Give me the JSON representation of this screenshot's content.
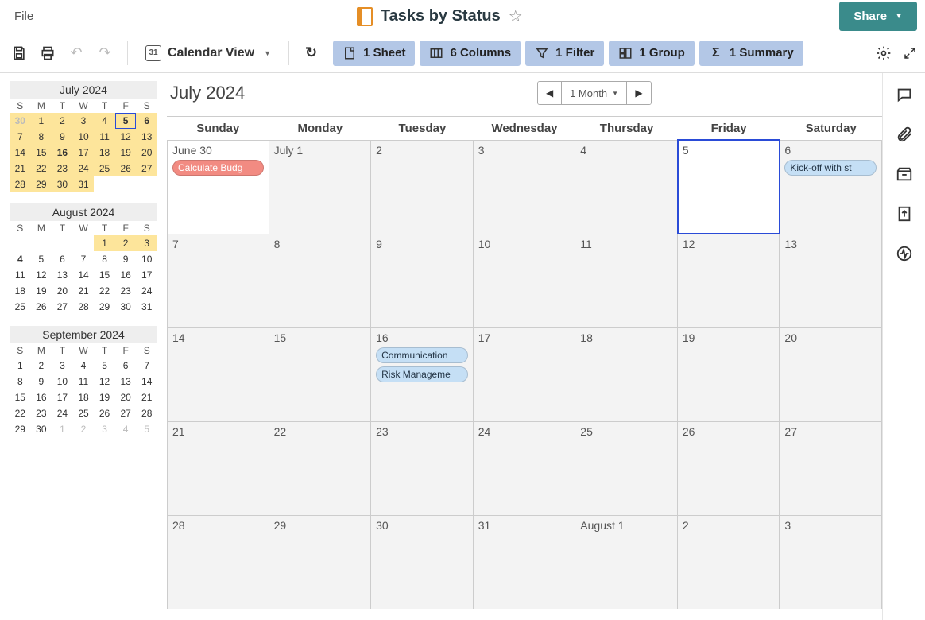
{
  "header": {
    "file_menu": "File",
    "title": "Tasks by Status",
    "share_label": "Share"
  },
  "toolbar": {
    "view_label": "Calendar View",
    "pills": {
      "sheet": "1 Sheet",
      "columns": "6 Columns",
      "filter": "1 Filter",
      "group": "1 Group",
      "summary": "1 Summary"
    }
  },
  "main": {
    "month_title": "July 2024",
    "range_label": "1 Month",
    "weekdays": [
      "Sunday",
      "Monday",
      "Tuesday",
      "Wednesday",
      "Thursday",
      "Friday",
      "Saturday"
    ],
    "rows": [
      [
        {
          "label": "June 30",
          "white": true,
          "events": [
            {
              "text": "Calculate Budg",
              "color": "red"
            }
          ]
        },
        {
          "label": "July 1"
        },
        {
          "label": "2"
        },
        {
          "label": "3"
        },
        {
          "label": "4"
        },
        {
          "label": "5",
          "selected": true
        },
        {
          "label": "6",
          "events": [
            {
              "text": "Kick-off with st",
              "color": "blue"
            }
          ]
        }
      ],
      [
        {
          "label": "7"
        },
        {
          "label": "8"
        },
        {
          "label": "9"
        },
        {
          "label": "10"
        },
        {
          "label": "11"
        },
        {
          "label": "12"
        },
        {
          "label": "13"
        }
      ],
      [
        {
          "label": "14"
        },
        {
          "label": "15"
        },
        {
          "label": "16",
          "events": [
            {
              "text": "Communication",
              "color": "blue"
            },
            {
              "text": "Risk Manageme",
              "color": "blue"
            }
          ]
        },
        {
          "label": "17"
        },
        {
          "label": "18"
        },
        {
          "label": "19"
        },
        {
          "label": "20"
        }
      ],
      [
        {
          "label": "21"
        },
        {
          "label": "22"
        },
        {
          "label": "23"
        },
        {
          "label": "24"
        },
        {
          "label": "25"
        },
        {
          "label": "26"
        },
        {
          "label": "27"
        }
      ],
      [
        {
          "label": "28"
        },
        {
          "label": "29"
        },
        {
          "label": "30"
        },
        {
          "label": "31"
        },
        {
          "label": "August 1"
        },
        {
          "label": "2"
        },
        {
          "label": "3"
        }
      ]
    ]
  },
  "mini_calendars": [
    {
      "title": "July 2024",
      "dow": [
        "S",
        "M",
        "T",
        "W",
        "T",
        "F",
        "S"
      ],
      "days": [
        {
          "n": "30",
          "dim": true,
          "hl": true,
          "bold": true
        },
        {
          "n": "1",
          "hl": true
        },
        {
          "n": "2",
          "hl": true
        },
        {
          "n": "3",
          "hl": true
        },
        {
          "n": "4",
          "hl": true
        },
        {
          "n": "5",
          "hl": true,
          "today": true
        },
        {
          "n": "6",
          "hl": true,
          "bold": true
        },
        {
          "n": "7",
          "hl": true
        },
        {
          "n": "8",
          "hl": true
        },
        {
          "n": "9",
          "hl": true
        },
        {
          "n": "10",
          "hl": true
        },
        {
          "n": "11",
          "hl": true
        },
        {
          "n": "12",
          "hl": true
        },
        {
          "n": "13",
          "hl": true
        },
        {
          "n": "14",
          "hl": true
        },
        {
          "n": "15",
          "hl": true
        },
        {
          "n": "16",
          "hl": true,
          "bold": true
        },
        {
          "n": "17",
          "hl": true
        },
        {
          "n": "18",
          "hl": true
        },
        {
          "n": "19",
          "hl": true
        },
        {
          "n": "20",
          "hl": true
        },
        {
          "n": "21",
          "hl": true
        },
        {
          "n": "22",
          "hl": true
        },
        {
          "n": "23",
          "hl": true
        },
        {
          "n": "24",
          "hl": true
        },
        {
          "n": "25",
          "hl": true
        },
        {
          "n": "26",
          "hl": true
        },
        {
          "n": "27",
          "hl": true
        },
        {
          "n": "28",
          "hl": true
        },
        {
          "n": "29",
          "hl": true
        },
        {
          "n": "30",
          "hl": true
        },
        {
          "n": "31",
          "hl": true
        }
      ]
    },
    {
      "title": "August 2024",
      "dow": [
        "S",
        "M",
        "T",
        "W",
        "T",
        "F",
        "S"
      ],
      "days": [
        {
          "n": ""
        },
        {
          "n": ""
        },
        {
          "n": ""
        },
        {
          "n": ""
        },
        {
          "n": "1",
          "hl": true
        },
        {
          "n": "2",
          "hl": true
        },
        {
          "n": "3",
          "hl": true
        },
        {
          "n": "4",
          "bold": true
        },
        {
          "n": "5"
        },
        {
          "n": "6"
        },
        {
          "n": "7"
        },
        {
          "n": "8"
        },
        {
          "n": "9"
        },
        {
          "n": "10"
        },
        {
          "n": "11"
        },
        {
          "n": "12"
        },
        {
          "n": "13"
        },
        {
          "n": "14"
        },
        {
          "n": "15"
        },
        {
          "n": "16"
        },
        {
          "n": "17"
        },
        {
          "n": "18"
        },
        {
          "n": "19"
        },
        {
          "n": "20"
        },
        {
          "n": "21"
        },
        {
          "n": "22"
        },
        {
          "n": "23"
        },
        {
          "n": "24"
        },
        {
          "n": "25"
        },
        {
          "n": "26"
        },
        {
          "n": "27"
        },
        {
          "n": "28"
        },
        {
          "n": "29"
        },
        {
          "n": "30"
        },
        {
          "n": "31"
        }
      ]
    },
    {
      "title": "September 2024",
      "dow": [
        "S",
        "M",
        "T",
        "W",
        "T",
        "F",
        "S"
      ],
      "days": [
        {
          "n": "1"
        },
        {
          "n": "2"
        },
        {
          "n": "3"
        },
        {
          "n": "4"
        },
        {
          "n": "5"
        },
        {
          "n": "6"
        },
        {
          "n": "7"
        },
        {
          "n": "8"
        },
        {
          "n": "9"
        },
        {
          "n": "10"
        },
        {
          "n": "11"
        },
        {
          "n": "12"
        },
        {
          "n": "13"
        },
        {
          "n": "14"
        },
        {
          "n": "15"
        },
        {
          "n": "16"
        },
        {
          "n": "17"
        },
        {
          "n": "18"
        },
        {
          "n": "19"
        },
        {
          "n": "20"
        },
        {
          "n": "21"
        },
        {
          "n": "22"
        },
        {
          "n": "23"
        },
        {
          "n": "24"
        },
        {
          "n": "25"
        },
        {
          "n": "26"
        },
        {
          "n": "27"
        },
        {
          "n": "28"
        },
        {
          "n": "29"
        },
        {
          "n": "30"
        },
        {
          "n": "1",
          "dim": true
        },
        {
          "n": "2",
          "dim": true
        },
        {
          "n": "3",
          "dim": true
        },
        {
          "n": "4",
          "dim": true
        },
        {
          "n": "5",
          "dim": true
        }
      ]
    }
  ]
}
